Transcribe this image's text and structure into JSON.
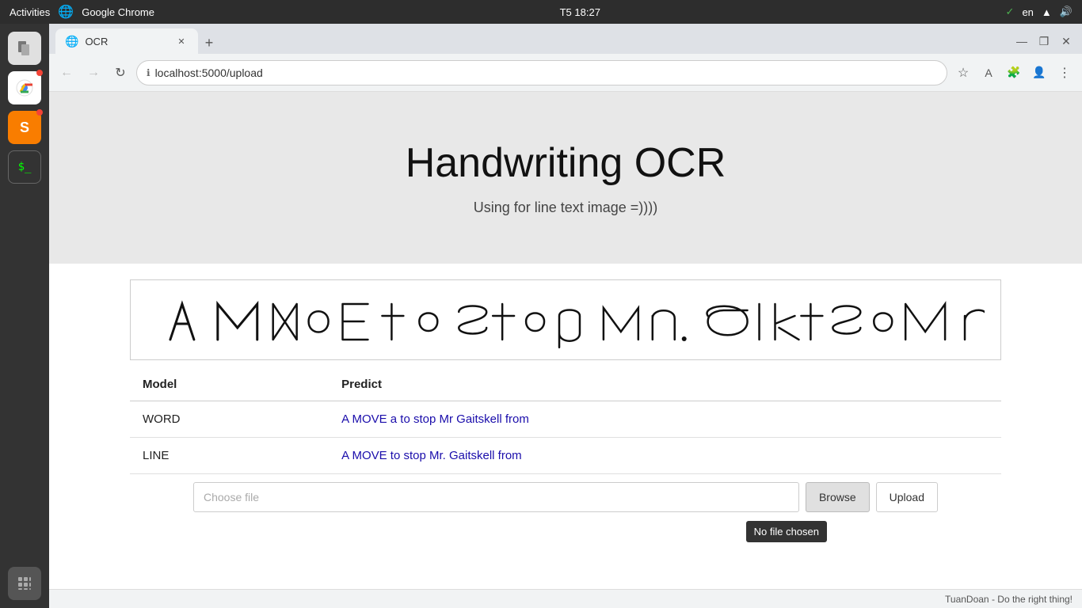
{
  "os": {
    "topbar": {
      "activities": "Activities",
      "app_name": "Google Chrome",
      "time": "T5 18:27",
      "lang": "en"
    }
  },
  "browser": {
    "tab": {
      "favicon": "🌐",
      "title": "OCR"
    },
    "address": "localhost:5000/upload",
    "window_controls": {
      "minimize": "—",
      "maximize": "❐",
      "close": "✕"
    }
  },
  "page": {
    "title": "Handwriting OCR",
    "subtitle": "Using for line text image =))))",
    "table": {
      "col_model": "Model",
      "col_predict": "Predict",
      "rows": [
        {
          "model": "WORD",
          "predict": "A MOVE a to stop Mr Gaitskell from"
        },
        {
          "model": "LINE",
          "predict": "A MOVE to stop Mr. Gaitskell from"
        }
      ]
    },
    "upload": {
      "placeholder": "Choose file",
      "browse_label": "Browse",
      "upload_label": "Upload",
      "no_file": "No file chosen"
    },
    "status_bar": "TuanDoan - Do the right thing!"
  }
}
